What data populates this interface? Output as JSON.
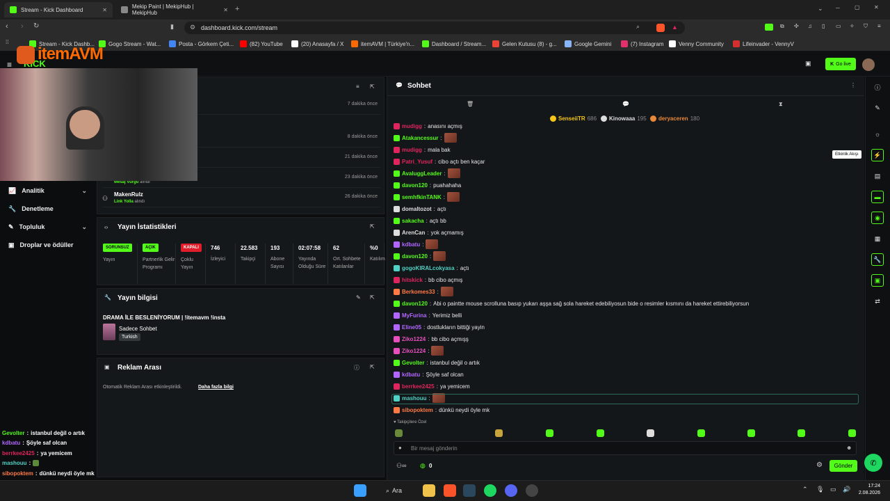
{
  "browser": {
    "tabs": [
      {
        "title": "Stream - Kick Dashboard"
      },
      {
        "title": "Mekip Paint | MekipHub | MekipHub"
      }
    ],
    "url": "dashboard.kick.com/stream"
  },
  "bookmarks": [
    {
      "label": "Stream - Kick Dashb...",
      "color": "#53fc18"
    },
    {
      "label": "Gogo Stream - Wat...",
      "color": "#53fc18"
    },
    {
      "label": "Posta - Görkem Çeti...",
      "color": "#4285f4"
    },
    {
      "label": "(82) YouTube",
      "color": "#ff0000"
    },
    {
      "label": "(20) Anasayfa / X",
      "color": "#ffffff"
    },
    {
      "label": "itemAVM | Türkiye'n...",
      "color": "#ff6a00"
    },
    {
      "label": "Dashboard / Stream...",
      "color": "#53fc18"
    },
    {
      "label": "Gelen Kutusu (8) - g...",
      "color": "#ea4335"
    },
    {
      "label": "Google Gemini",
      "color": "#8ab4f8"
    },
    {
      "label": "(7) Instagram",
      "color": "#e1306c"
    },
    {
      "label": "Venny Community",
      "color": "#ffffff"
    },
    {
      "label": "Lifeinvader - VennyV",
      "color": "#d32f2f"
    }
  ],
  "overlay": {
    "brand": "itemAVM"
  },
  "header": {
    "go_live": "Go live"
  },
  "nav": [
    {
      "label": "Analitik",
      "chev": "⌄"
    },
    {
      "label": "Denetleme",
      "chev": ""
    },
    {
      "label": "Topluluk",
      "chev": "⌄"
    },
    {
      "label": "Droplar ve ödüller",
      "chev": ""
    }
  ],
  "events": {
    "rows": [
      {
        "name": "",
        "sub": "",
        "time": "7 dakika önce"
      },
      {
        "name": "",
        "sub": "",
        "time": "8 dakika önce"
      },
      {
        "name": "",
        "sub": "",
        "time": "21 dakika önce"
      },
      {
        "name": "",
        "sub": "Mesaj Vurgu",
        "sub2": "alındı",
        "time": "23 dakika önce"
      },
      {
        "name": "MakenRulz",
        "sub": "Link Yolla",
        "sub2": "alındı",
        "time": "26 dakika önce"
      }
    ]
  },
  "stats": {
    "title": "Yayın İstatistikleri",
    "cols": [
      {
        "badge": "SORUNSUZ",
        "badge_color": "#53fc18",
        "label": "Yayın"
      },
      {
        "badge": "AÇIK",
        "badge_color": "#53fc18",
        "label": "Partnerlik Gelir Programı"
      },
      {
        "badge": "KAPALI",
        "badge_color": "#e11d2b",
        "label": "Çoklu Yayın"
      },
      {
        "value": "746",
        "label": "İzleyici"
      },
      {
        "value": "22.583",
        "label": "Takipçi"
      },
      {
        "value": "193",
        "label": "Abone Sayısı"
      },
      {
        "value": "02:07:58",
        "label": "Yayında Olduğu Süre"
      },
      {
        "value": "62",
        "label": "Ort. Sohbete Katılanlar"
      },
      {
        "value": "%0",
        "label": "Katılım"
      }
    ]
  },
  "info": {
    "title": "Yayın bilgisi",
    "stream_title": "DRAMA İLE BESLENİYORUM | !itemavm !insta",
    "category": "Sadece Sohbet",
    "language": "Turkish"
  },
  "ads": {
    "title": "Reklam Arası",
    "text": "Otomatik Reklam Arası etkinleştirildi.",
    "link": "Daha fazla bilgi"
  },
  "chat": {
    "title": "Sohbet",
    "leaders": [
      {
        "name": "SenseiiTR",
        "count": "686",
        "color": "#f5c518"
      },
      {
        "name": "Kinowaaa",
        "count": "195",
        "color": "#dddddd"
      },
      {
        "name": "deryaceren",
        "count": "180",
        "color": "#e8893a"
      }
    ],
    "messages": [
      {
        "user": "mudigg",
        "color": "#e0245e",
        "text": "anasını açmış",
        "emote": false
      },
      {
        "user": "Atakancessur",
        "color": "#53fc18",
        "text": "",
        "emote": true
      },
      {
        "user": "mudigg",
        "color": "#e0245e",
        "text": "mala bak",
        "emote": false
      },
      {
        "user": "Patri_Yusuf",
        "color": "#e0245e",
        "text": "cibo açtı ben kaçar",
        "emote": false
      },
      {
        "user": "AvaluggLeader",
        "color": "#53fc18",
        "text": "",
        "emote": true
      },
      {
        "user": "davon120",
        "color": "#53fc18",
        "text": "puahahaha",
        "emote": false
      },
      {
        "user": "semhfkinTANK",
        "color": "#53fc18",
        "text": "",
        "emote": true
      },
      {
        "user": "domaltozot",
        "color": "#dddddd",
        "text": "açtı",
        "emote": false
      },
      {
        "user": "sakacha",
        "color": "#53fc18",
        "text": "açtı bb",
        "emote": false
      },
      {
        "user": "ArenCan",
        "color": "#dddddd",
        "text": "yok açmamış",
        "emote": false
      },
      {
        "user": "kdbatu",
        "color": "#b266ff",
        "text": "",
        "emote": true
      },
      {
        "user": "davon120",
        "color": "#53fc18",
        "text": "",
        "emote": true
      },
      {
        "user": "gogoKIRALcokyasa",
        "color": "#4fd1c5",
        "text": "açtı",
        "emote": false
      },
      {
        "user": "hitskick",
        "color": "#e0245e",
        "text": "bb cibo açmış",
        "emote": false
      },
      {
        "user": "Berkomes33",
        "color": "#ff7a45",
        "text": "",
        "emote": true
      },
      {
        "user": "davon120",
        "color": "#53fc18",
        "text": "Abi o paintte mouse scrolluna basıp yukarı aşşa sağ sola hareket edebiliyosun bide o resimler kısmını da hareket ettirebiliyorsun",
        "emote": false
      },
      {
        "user": "MyFurina",
        "color": "#b266ff",
        "text": "Yerimiz belli",
        "emote": false
      },
      {
        "user": "Eline05",
        "color": "#b266ff",
        "text": "dostlukların bittiği yayin",
        "emote": false
      },
      {
        "user": "Ziko1224",
        "color": "#e84fbe",
        "text": "bb cibo açmışş",
        "emote": false
      },
      {
        "user": "Ziko1224",
        "color": "#e84fbe",
        "text": "",
        "emote": true
      },
      {
        "user": "Gevolter",
        "color": "#53fc18",
        "text": "istanbul değil o artık",
        "emote": false
      },
      {
        "user": "kdbatu",
        "color": "#b266ff",
        "text": "Şöyle saf olcan",
        "emote": false
      },
      {
        "user": "berrkee2425",
        "color": "#e0245e",
        "text": "ya yemicem",
        "emote": false
      },
      {
        "user": "mashouu",
        "color": "#4fd1c5",
        "text": "",
        "emote": true
      },
      {
        "user": "sibopoktem",
        "color": "#ff7a45",
        "text": "dünkü neydi öyle mk",
        "emote": false
      }
    ],
    "followers_only": "Takipçilere Özel",
    "placeholder": "Bir mesaj gönderin",
    "points": "0",
    "send": "Gönder",
    "tooltip": "Etkinlik Akışı"
  },
  "overlay_chat": [
    {
      "user": "Gevolter",
      "color": "#53fc18",
      "text": "istanbul değil o artık"
    },
    {
      "user": "kdbatu",
      "color": "#b266ff",
      "text": "Şöyle saf olcan"
    },
    {
      "user": "berrkee2425",
      "color": "#e0245e",
      "text": "ya yemicem"
    },
    {
      "user": "mashouu",
      "color": "#4fd1c5",
      "text": ""
    },
    {
      "user": "sibopoktem",
      "color": "#ff7a45",
      "text": "dünkü neydi öyle mk"
    }
  ],
  "taskbar": {
    "search": "Ara",
    "time": "17:24",
    "date": "2.08.2026"
  }
}
